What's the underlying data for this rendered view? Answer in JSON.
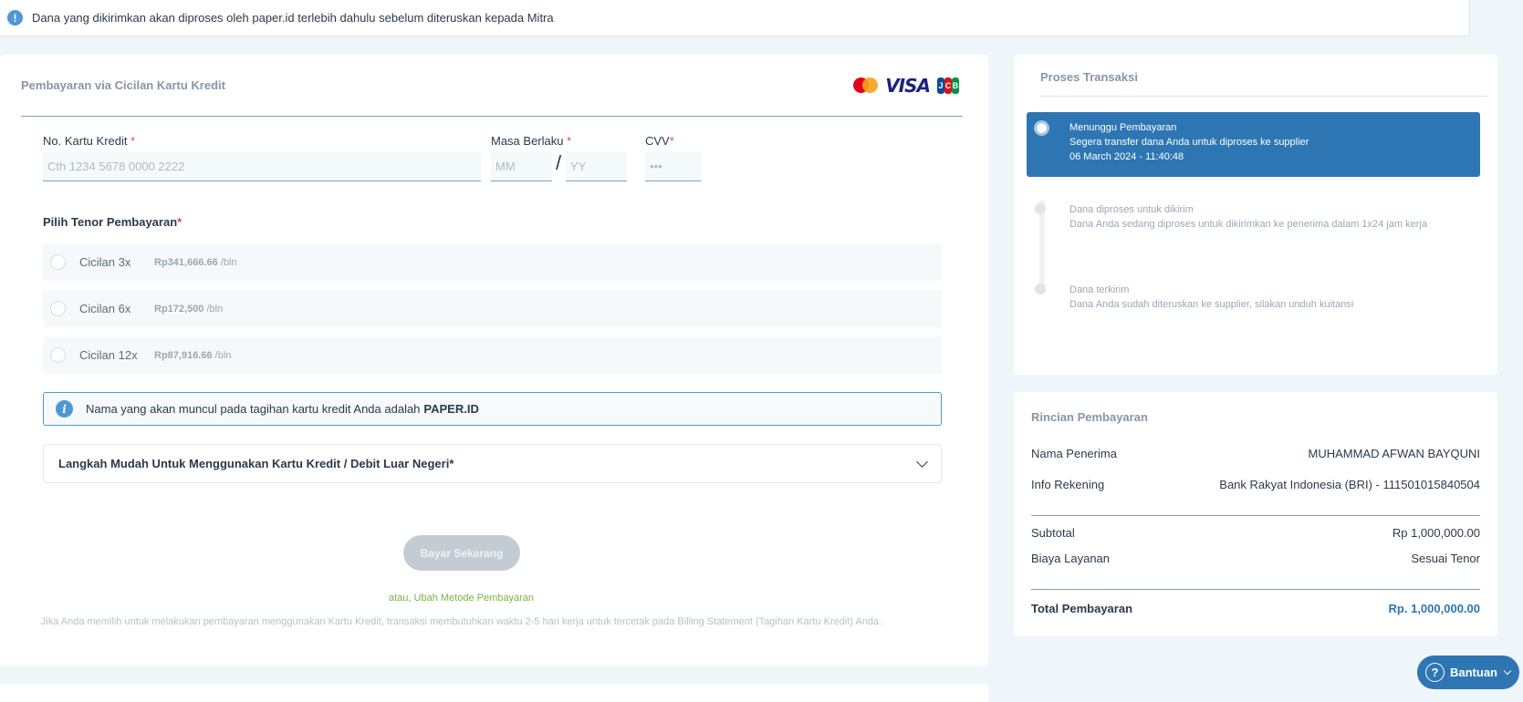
{
  "notice": {
    "icon": "exclamation-icon",
    "text": "Dana yang dikirimkan akan diproses oleh paper.id terlebih dahulu sebelum diteruskan kepada Mitra"
  },
  "payment": {
    "title": "Pembayaran via  Cicilan Kartu Kredit",
    "logos": [
      "mastercard-logo",
      "visa-logo",
      "jcb-logo"
    ],
    "visa_text": "VISA",
    "card_number": {
      "label": "No. Kartu Kredit",
      "required": "*",
      "placeholder": "Cth 1234 5678 0000 2222"
    },
    "expiry": {
      "label": "Masa Berlaku",
      "required": "*",
      "month_placeholder": "MM",
      "separator": "/",
      "year_placeholder": "YY"
    },
    "cvv": {
      "label": "CVV",
      "required": "*",
      "placeholder": "•••"
    },
    "tenor": {
      "title": "Pilih Tenor Pembayaran",
      "required": "*",
      "options": [
        {
          "name": "Cicilan 3x",
          "price": "Rp341,666.66",
          "unit": " /bln"
        },
        {
          "name": "Cicilan 6x",
          "price": "Rp172,500",
          "unit": " /bln"
        },
        {
          "name": "Cicilan 12x",
          "price": "Rp87,916.66",
          "unit": " /bln"
        }
      ]
    },
    "info": {
      "text": "Nama yang akan muncul pada tagihan kartu kredit Anda adalah",
      "highlight": "PAPER.ID"
    },
    "accordion_title": "Langkah Mudah Untuk Menggunakan Kartu Kredit / Debit Luar Negeri*",
    "pay_button": "Bayar Sekarang",
    "alt_link": "atau, Ubah Metode Pembayaran",
    "disclaimer": "Jika Anda memilih untuk melakukan pembayaran menggunakan Kartu Kredit, transaksi membutuhkan waktu 2-5 hari kerja untuk tercetak pada Billing Statement (Tagihan Kartu Kredit) Anda."
  },
  "process": {
    "title": "Proses Transaksi",
    "steps": [
      {
        "title": "Menunggu Pembayaran",
        "desc": "Segera transfer dana Anda untuk diproses ke supplier",
        "time": "06 March 2024 - 11:40:48"
      },
      {
        "title": "Dana diproses untuk dikirim",
        "desc": "Dana Anda sedang diproses untuk dikirimkan ke penerima dalam 1x24 jam kerja"
      },
      {
        "title": "Dana terkirim",
        "desc": "Dana Anda sudah diteruskan ke supplier, silakan unduh kuitansi"
      }
    ]
  },
  "details": {
    "title": "Rincian Pembayaran",
    "recipient_label": "Nama Penerima",
    "recipient_value": "MUHAMMAD AFWAN BAYQUNI",
    "account_label": "Info Rekening",
    "account_value": "Bank Rakyat Indonesia (BRI) - 111501015840504",
    "subtotal_label": "Subtotal",
    "subtotal_value": "Rp 1,000,000.00",
    "fee_label": "Biaya Layanan",
    "fee_value": "Sesuai Tenor",
    "total_label": "Total Pembayaran",
    "total_value": "Rp. 1,000,000.00"
  },
  "help": {
    "icon": "question-icon",
    "label": "Bantuan"
  },
  "colors": {
    "primary": "#2e76b3",
    "accent_green": "#79b33b",
    "required": "#e04c4c"
  }
}
